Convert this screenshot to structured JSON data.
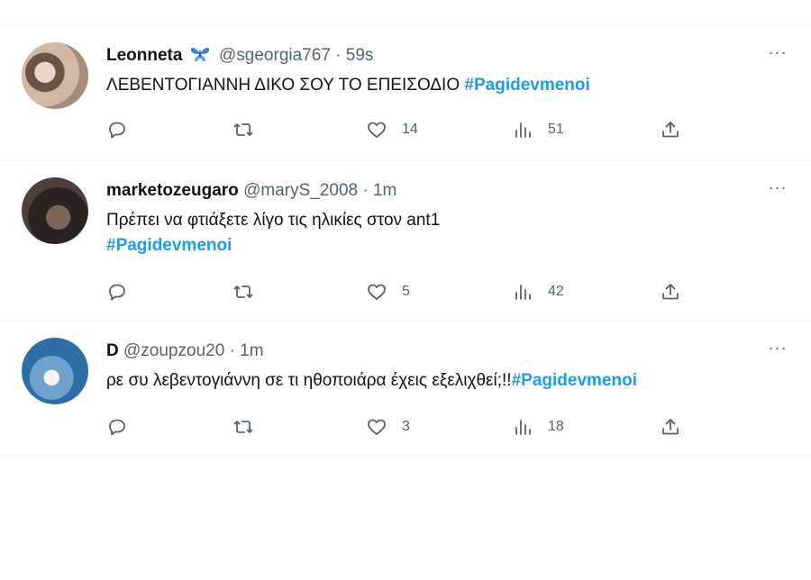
{
  "tweets": [
    {
      "name": "Leonneta",
      "badge_icon": "butterfly-icon",
      "handle": "@sgeorgia767",
      "dot": "·",
      "time": "59s",
      "text": "ΛΕΒΕΝΤΟΓΙΑΝΝΗ ΔΙΚΟ ΣΟΥ ΤΟ ΕΠΕΙΣΟΔΙΟ ",
      "hashtag": "#Pagidevmenoi",
      "likes": "14",
      "views": "51",
      "more": "···"
    },
    {
      "name": "marketozeugaro",
      "handle": "@maryS_2008",
      "dot": "·",
      "time": "1m",
      "text": "Πρέπει να φτιάξετε λίγο τις  ηλικίες στον ant1",
      "hashtag": "#Pagidevmenoi",
      "likes": "5",
      "views": "42",
      "more": "···"
    },
    {
      "name": "D",
      "handle": "@zoupzou20",
      "dot": "·",
      "time": "1m",
      "text": "ρε συ λεβεντογιάννη σε τι ηθοποιάρα έχεις εξελιχθεί;!!",
      "hashtag": "#Pagidevmenoi",
      "likes": "3",
      "views": "18",
      "more": "···"
    }
  ],
  "colors": {
    "hashtag": "#1d9bf0",
    "muted": "#536471",
    "text": "#0f1419",
    "divider": "#eff3f4"
  }
}
